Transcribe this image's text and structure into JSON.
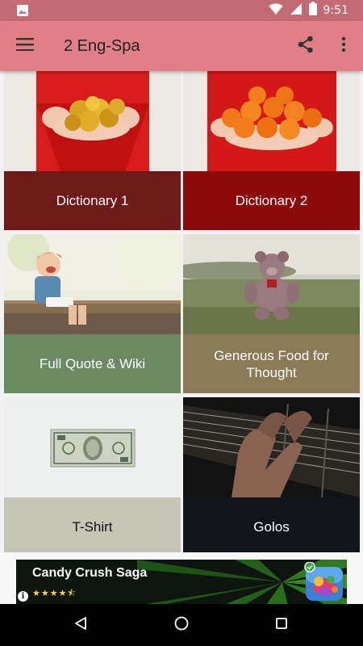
{
  "status_bar": {
    "time": "9:51",
    "icons": [
      "image-notification-icon",
      "wifi-icon",
      "signal-icon",
      "battery-icon"
    ]
  },
  "app_bar": {
    "title": "2 Eng-Spa",
    "icons": [
      "menu-icon",
      "share-icon",
      "more-vert-icon"
    ]
  },
  "tiles": [
    {
      "label": "Dictionary 1",
      "color": "#6e1a1a",
      "image": "hands holding gold coins"
    },
    {
      "label": "Dictionary 2",
      "color": "#8c0a0a",
      "image": "hands holding oranges"
    },
    {
      "label": "Full Quote & Wiki",
      "color": "#6a8a64",
      "image": "laughing child on bench"
    },
    {
      "label": "Generous Food for Thought",
      "color": "#8a7a56",
      "image": "teddy bear in field"
    },
    {
      "label": "T-Shirt",
      "color": "#c6c6b6",
      "image": "one dollar bill"
    },
    {
      "label": "Golos",
      "color": "#111418",
      "image": "hand on guitar neck"
    }
  ],
  "ad": {
    "title": "Candy Crush Saga",
    "stars": "★★★★⯪",
    "info": "i"
  },
  "nav_bar": {
    "icons": [
      "back-icon",
      "home-icon",
      "recents-icon"
    ]
  }
}
